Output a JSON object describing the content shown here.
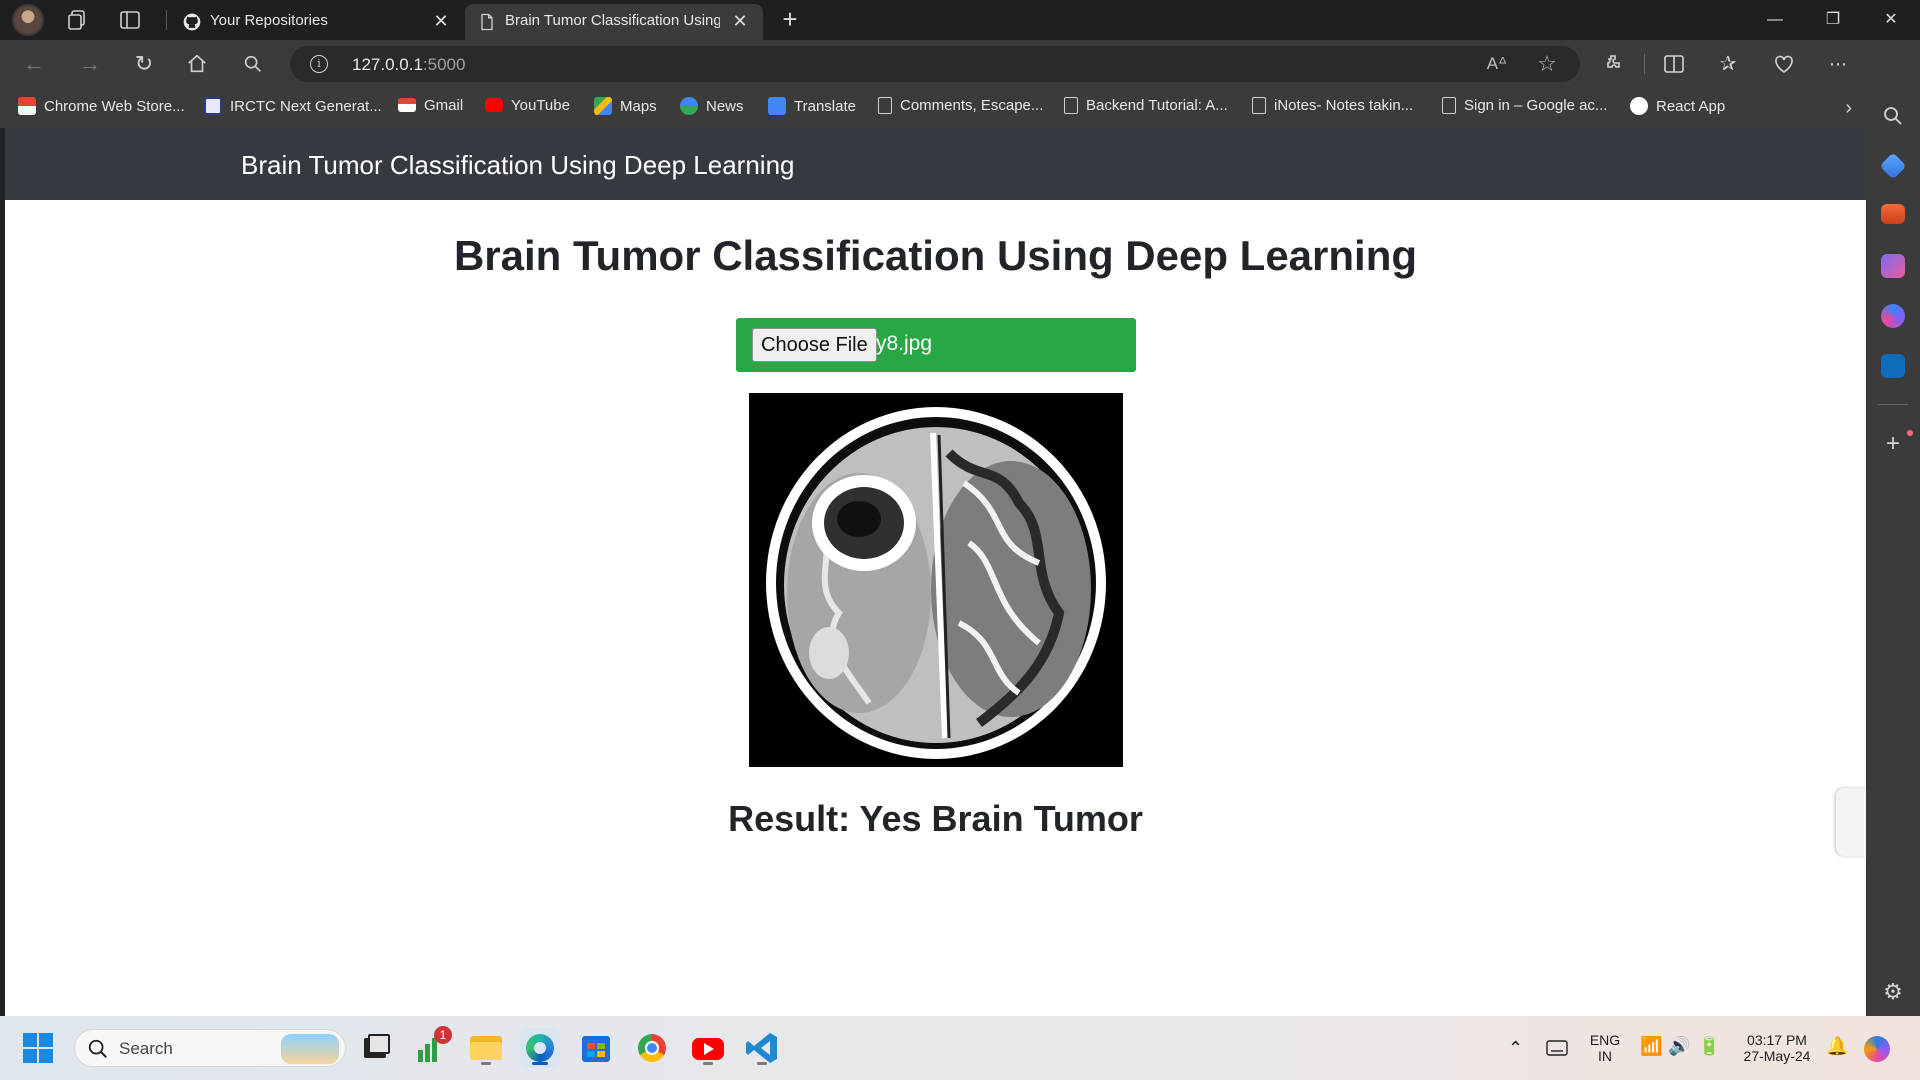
{
  "browser": {
    "tabs": [
      {
        "title": "Your Repositories",
        "active": false
      },
      {
        "title": "Brain Tumor Classification Using Deep Learning",
        "active": true
      }
    ],
    "address": {
      "host": "127.0.0.1",
      "port": ":5000"
    },
    "bookmarks": [
      "Chrome Web Store...",
      "IRCTC Next Generat...",
      "Gmail",
      "YouTube",
      "Maps",
      "News",
      "Translate",
      "Comments, Escape...",
      "Backend Tutorial: A...",
      "iNotes- Notes takin...",
      "Sign in – Google ac...",
      "React App"
    ]
  },
  "page": {
    "navbar_brand": "Brain Tumor Classification Using Deep Learning",
    "heading": "Brain Tumor Classification Using Deep Learning",
    "file_button": "Choose File",
    "file_name": "y8.jpg",
    "result": "Result: Yes Brain Tumor"
  },
  "taskbar": {
    "search_label": "Search",
    "badge_count": "1",
    "language": "ENG",
    "region": "IN",
    "time": "03:17 PM",
    "date": "27-May-24"
  },
  "colors": {
    "navbar": "#343a40",
    "upload_bg": "#28a745",
    "text_dark": "#212529"
  }
}
